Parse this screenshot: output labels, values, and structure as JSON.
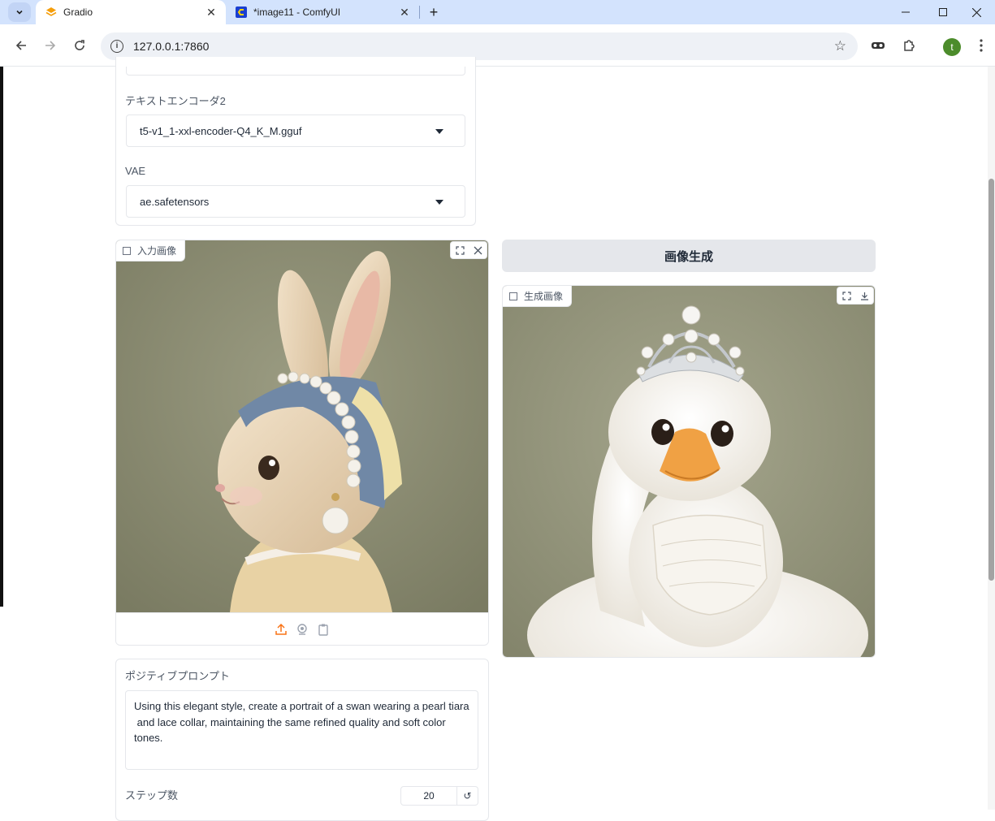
{
  "browser": {
    "tabs": [
      {
        "title": "Gradio",
        "active": true,
        "favicon": "gradio-icon"
      },
      {
        "title": "*image11 - ComfyUI",
        "active": false,
        "favicon": "comfyui-icon"
      }
    ],
    "url": "127.0.0.1:7860",
    "profile_initial": "t"
  },
  "model_panel": {
    "text_encoder2": {
      "label": "テキストエンコーダ2",
      "value": "t5-v1_1-xxl-encoder-Q4_K_M.gguf"
    },
    "vae": {
      "label": "VAE",
      "value": "ae.safetensors"
    }
  },
  "input_image": {
    "label": "入力画像",
    "subject": "rabbit-with-pearl-headscarf",
    "source_icons": [
      "upload-icon",
      "webcam-icon",
      "clipboard-icon"
    ]
  },
  "generate_button": {
    "label": "画像生成"
  },
  "output_image": {
    "label": "生成画像",
    "subject": "swan-with-pearl-tiara"
  },
  "prompt": {
    "label": "ポジティブプロンプト",
    "value": "Using this elegant style, create a portrait of a swan wearing a pearl tiara\n and lace collar, maintaining the same refined quality and soft color tones."
  },
  "steps": {
    "label": "ステップ数",
    "value": "20",
    "reset_icon": "↺"
  },
  "colors": {
    "accent": "#f97316",
    "button_bg": "#e5e7eb",
    "tab_bar": "#d3e3fd"
  }
}
